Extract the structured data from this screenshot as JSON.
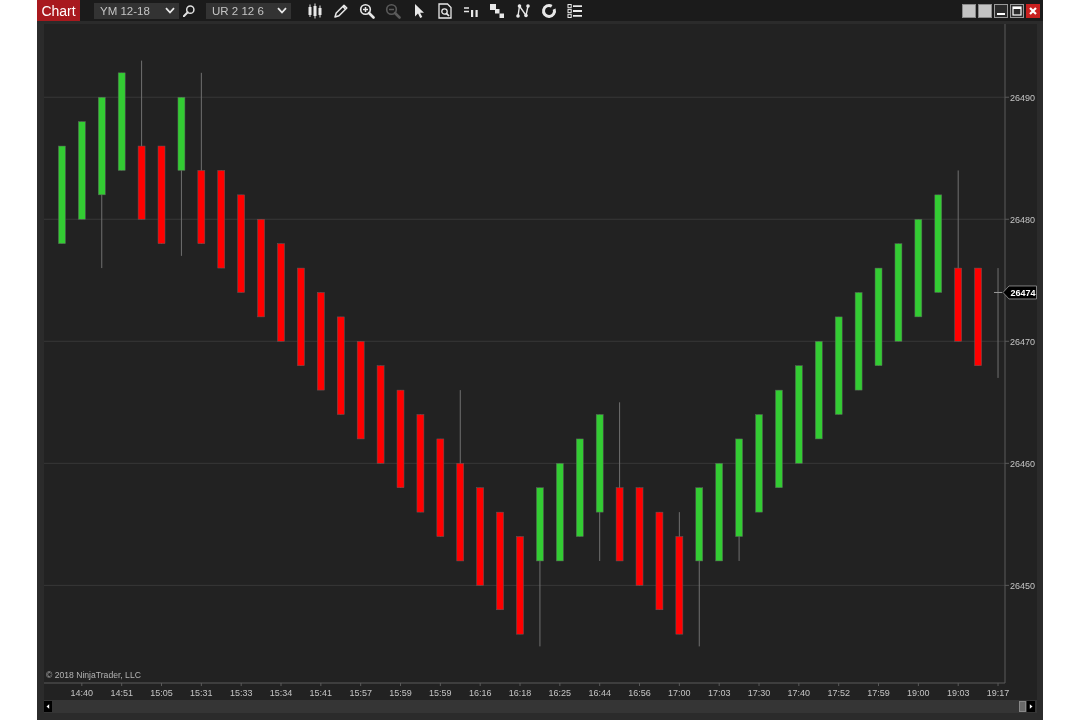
{
  "window": {
    "title": "Chart"
  },
  "toolbar": {
    "instrument": "YM 12-18",
    "bar_type": "UR 2 12 6",
    "tools": [
      {
        "disabled": false
      },
      {
        "disabled": false
      },
      {
        "disabled": false
      },
      {
        "disabled": true
      },
      {
        "disabled": false
      },
      {
        "disabled": false
      },
      {
        "disabled": false
      },
      {
        "disabled": false
      },
      {
        "disabled": false
      },
      {
        "disabled": false
      },
      {
        "disabled": false
      }
    ]
  },
  "chart": {
    "last_price": "26474",
    "copyright": "© 2018 NinjaTrader, LLC",
    "chart_data": {
      "type": "candlestick",
      "grid": true,
      "ylim": [
        26442,
        26496
      ],
      "yticks": [
        26450,
        26460,
        26470,
        26480,
        26490
      ],
      "categories": [
        null,
        "14:40",
        null,
        "14:51",
        null,
        "15:05",
        null,
        "15:31",
        null,
        "15:33",
        null,
        "15:34",
        null,
        "15:41",
        null,
        "15:57",
        null,
        "15:59",
        null,
        "15:59",
        null,
        "16:16",
        null,
        "16:18",
        null,
        "16:25",
        null,
        "16:44",
        null,
        "16:56",
        null,
        "17:00",
        null,
        "17:03",
        null,
        "17:30",
        null,
        "17:40",
        null,
        "17:52",
        null,
        "17:59",
        null,
        "19:00",
        null,
        "19:03",
        null,
        "19:17"
      ],
      "ohlc": [
        [
          26478,
          26486,
          26478,
          26486
        ],
        [
          26480,
          26488,
          26480,
          26488
        ],
        [
          26482,
          26490,
          26476,
          26490
        ],
        [
          26484,
          26492,
          26484,
          26492
        ],
        [
          26486,
          26493,
          26480,
          26480
        ],
        [
          26486,
          26486,
          26478,
          26478
        ],
        [
          26484,
          26490,
          26477,
          26490
        ],
        [
          26484,
          26492,
          26478,
          26478
        ],
        [
          26484,
          26484,
          26476,
          26476
        ],
        [
          26482,
          26482,
          26474,
          26474
        ],
        [
          26480,
          26480,
          26472,
          26472
        ],
        [
          26478,
          26478,
          26470,
          26470
        ],
        [
          26476,
          26476,
          26468,
          26468
        ],
        [
          26474,
          26474,
          26466,
          26466
        ],
        [
          26472,
          26472,
          26464,
          26464
        ],
        [
          26470,
          26470,
          26462,
          26462
        ],
        [
          26468,
          26468,
          26460,
          26460
        ],
        [
          26466,
          26466,
          26458,
          26458
        ],
        [
          26464,
          26464,
          26456,
          26456
        ],
        [
          26462,
          26462,
          26454,
          26454
        ],
        [
          26460,
          26466,
          26452,
          26452
        ],
        [
          26458,
          26458,
          26450,
          26450
        ],
        [
          26456,
          26456,
          26448,
          26448
        ],
        [
          26454,
          26454,
          26446,
          26446
        ],
        [
          26452,
          26458,
          26445,
          26458
        ],
        [
          26452,
          26460,
          26452,
          26460
        ],
        [
          26454,
          26462,
          26454,
          26462
        ],
        [
          26456,
          26464,
          26452,
          26464
        ],
        [
          26458,
          26465,
          26452,
          26452
        ],
        [
          26458,
          26458,
          26450,
          26450
        ],
        [
          26456,
          26456,
          26448,
          26448
        ],
        [
          26454,
          26456,
          26446,
          26446
        ],
        [
          26452,
          26458,
          26445,
          26458
        ],
        [
          26452,
          26460,
          26452,
          26460
        ],
        [
          26454,
          26462,
          26452,
          26462
        ],
        [
          26456,
          26464,
          26456,
          26464
        ],
        [
          26458,
          26466,
          26458,
          26466
        ],
        [
          26460,
          26468,
          26460,
          26468
        ],
        [
          26462,
          26470,
          26462,
          26470
        ],
        [
          26464,
          26472,
          26464,
          26472
        ],
        [
          26466,
          26474,
          26466,
          26474
        ],
        [
          26468,
          26476,
          26468,
          26476
        ],
        [
          26470,
          26478,
          26470,
          26478
        ],
        [
          26472,
          26480,
          26472,
          26480
        ],
        [
          26474,
          26482,
          26474,
          26482
        ],
        [
          26476,
          26484,
          26470,
          26470
        ],
        [
          26476,
          26476,
          26468,
          26468
        ],
        [
          26474,
          26476,
          26467,
          26474
        ]
      ]
    }
  }
}
